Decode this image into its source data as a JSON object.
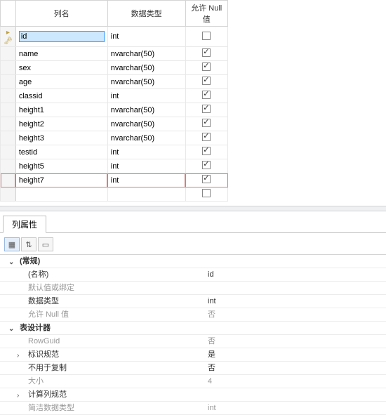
{
  "table": {
    "headers": {
      "name": "列名",
      "type": "数据类型",
      "allow_null": "允许 Null 值"
    },
    "rows": [
      {
        "name": "id",
        "type": "int",
        "allow_null": false,
        "selected": true,
        "key": true
      },
      {
        "name": "name",
        "type": "nvarchar(50)",
        "allow_null": true
      },
      {
        "name": "sex",
        "type": "nvarchar(50)",
        "allow_null": true
      },
      {
        "name": "age",
        "type": "nvarchar(50)",
        "allow_null": true
      },
      {
        "name": "classid",
        "type": "int",
        "allow_null": true
      },
      {
        "name": "height1",
        "type": "nvarchar(50)",
        "allow_null": true
      },
      {
        "name": "height2",
        "type": "nvarchar(50)",
        "allow_null": true
      },
      {
        "name": "height3",
        "type": "nvarchar(50)",
        "allow_null": true
      },
      {
        "name": "testid",
        "type": "int",
        "allow_null": true
      },
      {
        "name": "height5",
        "type": "int",
        "allow_null": true
      },
      {
        "name": "height7",
        "type": "int",
        "allow_null": true,
        "highlighted": true
      }
    ]
  },
  "props": {
    "tab_label": "列属性",
    "toolbar": {
      "categorized": "▦",
      "sort": "⇅",
      "page": "▭"
    },
    "categories": {
      "general": {
        "label": "(常规)",
        "rows": [
          {
            "k": "(名称)",
            "v": "id"
          },
          {
            "k": "默认值或绑定",
            "v": "",
            "dim": true
          },
          {
            "k": "数据类型",
            "v": "int"
          },
          {
            "k": "允许 Null 值",
            "v": "否",
            "dim": true
          }
        ]
      },
      "designer": {
        "label": "表设计器",
        "rows": [
          {
            "k": "RowGuid",
            "v": "否",
            "dim": true
          },
          {
            "k": "标识规范",
            "v": "是",
            "expand": true
          },
          {
            "k": "不用于复制",
            "v": "否"
          },
          {
            "k": "大小",
            "v": "4",
            "dim": true
          },
          {
            "k": "计算列规范",
            "v": "",
            "expand": true
          },
          {
            "k": "简洁数据类型",
            "v": "int",
            "dim": true
          }
        ]
      }
    }
  }
}
